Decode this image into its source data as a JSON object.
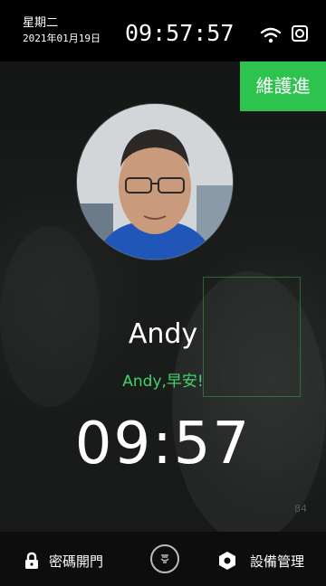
{
  "status_bar": {
    "weekday": "星期二",
    "date": "2021年01月19日",
    "time": "09:57:57"
  },
  "maintenance_label": "維護進",
  "recognition": {
    "user_name": "Andy",
    "greeting": "Andy,早安!",
    "clock": "09:57",
    "corner_number": "84"
  },
  "bottom_bar": {
    "password_open_label": "密碼開門",
    "device_manage_label": "設備管理"
  },
  "colors": {
    "accent_green": "#2ec24f",
    "greeting_green": "#43d26a",
    "status_bar_bg": "#000000"
  },
  "icons": {
    "status": [
      "wifi-icon",
      "device-icon"
    ],
    "bottom": [
      "lock-icon",
      "doorbell-icon",
      "settings-hex-icon"
    ]
  }
}
